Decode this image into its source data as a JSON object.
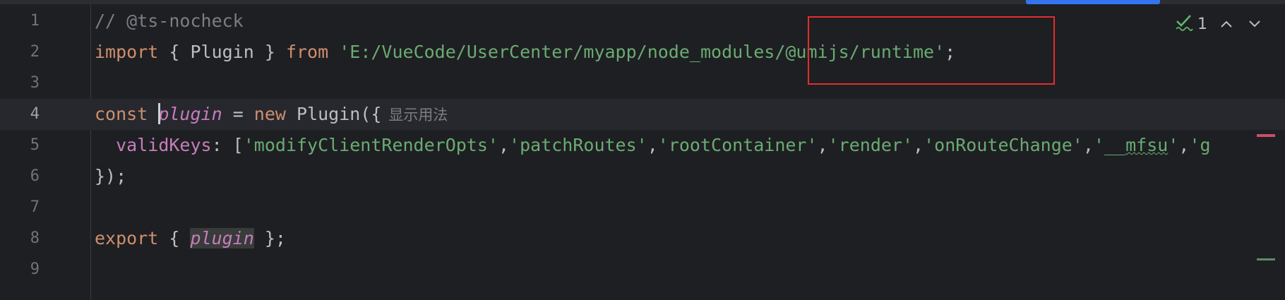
{
  "editor": {
    "lines": [
      {
        "number": "1",
        "comment": "// @ts-nocheck"
      },
      {
        "number": "2",
        "kw_import": "import",
        "p1": " { Plugin } ",
        "kw_from": "from",
        "space": " ",
        "str_path": "'E:/VueCode/UserCenter/myapp/node_modules/@umijs/runtime'",
        "end": ";"
      },
      {
        "number": "3"
      },
      {
        "number": "4",
        "kw_const": "const",
        "space": " ",
        "var": "plugin",
        "p1": " = ",
        "kw_new": "new",
        "p2": " Plugin({",
        "hint": "显示用法"
      },
      {
        "number": "5",
        "indent": "  ",
        "prop": "validKeys",
        "p1": ": [",
        "s1": "'modifyClientRenderOpts'",
        "c1": ",",
        "s2": "'patchRoutes'",
        "c2": ",",
        "s3": "'rootContainer'",
        "c3": ",",
        "s4": "'render'",
        "c4": ",",
        "s5": "'onRouteChange'",
        "c5": ",",
        "s6a": "'__",
        "s6b": "mfsu",
        "s6c": "'",
        "c6": ",",
        "s7": "'g"
      },
      {
        "number": "6",
        "text": "});"
      },
      {
        "number": "7"
      },
      {
        "number": "8",
        "kw_export": "export",
        "p1": " { ",
        "var": "plugin",
        "p2": " };"
      },
      {
        "number": "9"
      }
    ]
  },
  "inspection": {
    "check_icon": "check-squiggle-icon",
    "count": "1",
    "up_glyph": "∧",
    "down_glyph": "∨"
  },
  "colors": {
    "background": "#1e1f22",
    "keyword": "#cf8e6d",
    "string": "#6aab73",
    "property": "#c77dbb",
    "comment": "#7a7e85",
    "annotation_box": "#e52d2d"
  }
}
